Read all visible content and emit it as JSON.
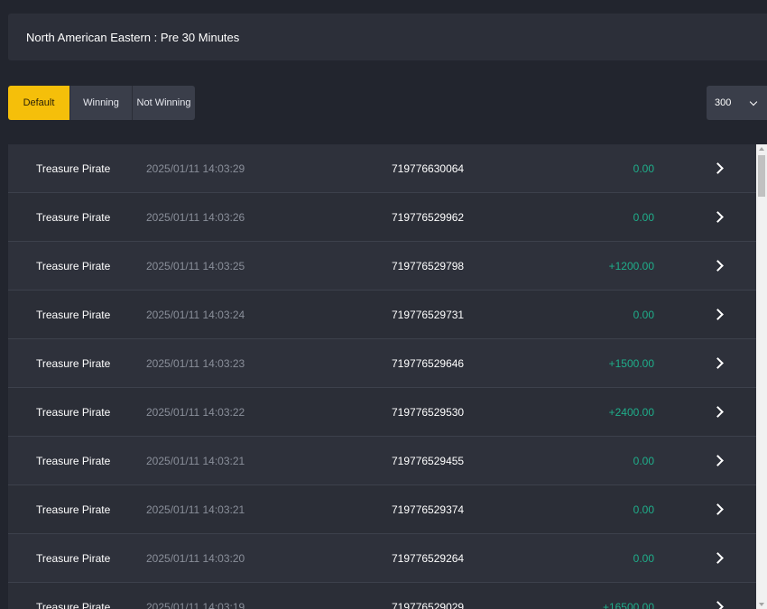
{
  "header": {
    "title": "North American Eastern : Pre 30 Minutes"
  },
  "filters": [
    {
      "label": "Default",
      "active": true
    },
    {
      "label": "Winning",
      "active": false
    },
    {
      "label": "Not Winning",
      "active": false
    }
  ],
  "page_size": {
    "value": "300"
  },
  "colors": {
    "accent": "#f5bf0a",
    "win_amount": "#1fae8a",
    "background": "#22252e"
  },
  "rows": [
    {
      "game": "Treasure Pirate",
      "time": "2025/01/11 14:03:29",
      "id": "719776630064",
      "amount": "0.00"
    },
    {
      "game": "Treasure Pirate",
      "time": "2025/01/11 14:03:26",
      "id": "719776529962",
      "amount": "0.00"
    },
    {
      "game": "Treasure Pirate",
      "time": "2025/01/11 14:03:25",
      "id": "719776529798",
      "amount": "+1200.00"
    },
    {
      "game": "Treasure Pirate",
      "time": "2025/01/11 14:03:24",
      "id": "719776529731",
      "amount": "0.00"
    },
    {
      "game": "Treasure Pirate",
      "time": "2025/01/11 14:03:23",
      "id": "719776529646",
      "amount": "+1500.00"
    },
    {
      "game": "Treasure Pirate",
      "time": "2025/01/11 14:03:22",
      "id": "719776529530",
      "amount": "+2400.00"
    },
    {
      "game": "Treasure Pirate",
      "time": "2025/01/11 14:03:21",
      "id": "719776529455",
      "amount": "0.00"
    },
    {
      "game": "Treasure Pirate",
      "time": "2025/01/11 14:03:21",
      "id": "719776529374",
      "amount": "0.00"
    },
    {
      "game": "Treasure Pirate",
      "time": "2025/01/11 14:03:20",
      "id": "719776529264",
      "amount": "0.00"
    },
    {
      "game": "Treasure Pirate",
      "time": "2025/01/11 14:03:19",
      "id": "719776529029",
      "amount": "+16500.00"
    }
  ]
}
